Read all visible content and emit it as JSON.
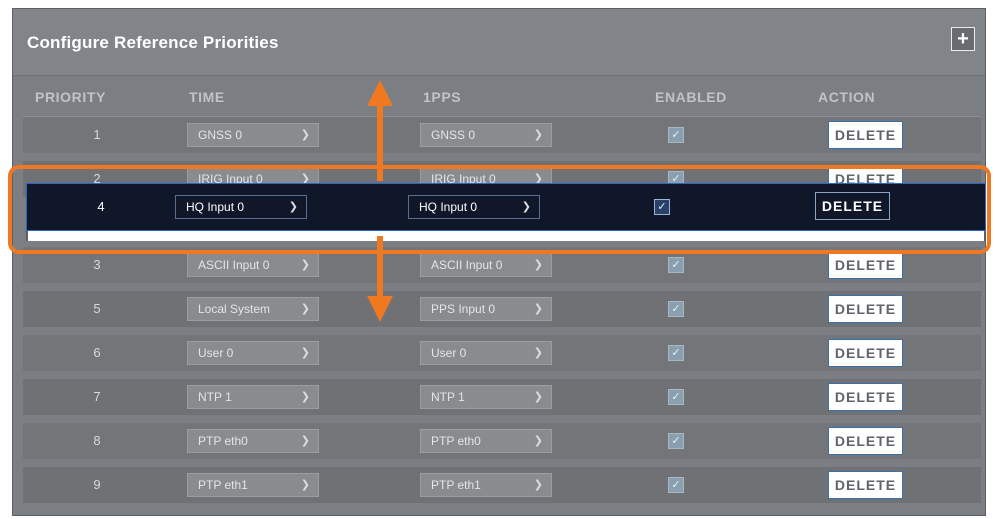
{
  "panel": {
    "title": "Configure Reference Priorities",
    "add_label": "+"
  },
  "columns": {
    "priority": "PRIORITY",
    "time": "TIME",
    "pps": "1PPS",
    "enabled": "ENABLED",
    "action": "ACTION"
  },
  "rows": [
    {
      "priority": "1",
      "time": "GNSS 0",
      "pps": "GNSS 0",
      "enabled": true,
      "action": "DELETE"
    },
    {
      "priority": "2",
      "time": "IRIG Input 0",
      "pps": "IRIG Input 0",
      "enabled": true,
      "action": "DELETE"
    },
    {
      "priority": "3",
      "time": "ASCII Input 0",
      "pps": "ASCII Input 0",
      "enabled": true,
      "action": "DELETE"
    },
    {
      "priority": "5",
      "time": "Local System",
      "pps": "PPS Input 0",
      "enabled": true,
      "action": "DELETE"
    },
    {
      "priority": "6",
      "time": "User 0",
      "pps": "User 0",
      "enabled": true,
      "action": "DELETE"
    },
    {
      "priority": "7",
      "time": "NTP 1",
      "pps": "NTP 1",
      "enabled": true,
      "action": "DELETE"
    },
    {
      "priority": "8",
      "time": "PTP eth0",
      "pps": "PTP eth0",
      "enabled": true,
      "action": "DELETE"
    },
    {
      "priority": "9",
      "time": "PTP eth1",
      "pps": "PTP eth1",
      "enabled": true,
      "action": "DELETE"
    }
  ],
  "dragged_row": {
    "priority": "4",
    "time": "HQ Input 0",
    "pps": "HQ Input 0",
    "enabled": true,
    "action": "DELETE"
  },
  "icons": {
    "chevron": "chevron-down-icon",
    "check": "checkmark-icon",
    "drag_up": "arrow-up-icon",
    "drag_down": "arrow-down-icon"
  },
  "colors": {
    "highlight": "#f07820",
    "drag_row_bg": "#0f1729",
    "drag_row_border": "#2b66c6"
  }
}
